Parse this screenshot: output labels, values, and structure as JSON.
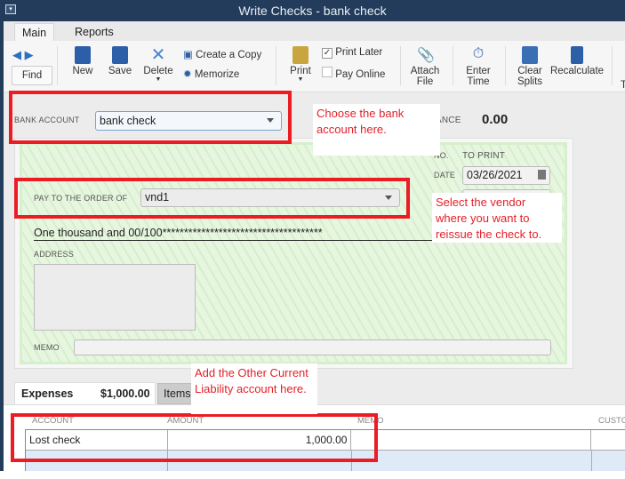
{
  "window": {
    "title": "Write Checks - bank check"
  },
  "ribbon_tabs": [
    {
      "label": "Main"
    },
    {
      "label": "Reports"
    }
  ],
  "toolbar": {
    "find": "Find",
    "new": "New",
    "save": "Save",
    "delete": "Delete",
    "create_copy": "Create a Copy",
    "memorize": "Memorize",
    "print": "Print",
    "print_later": "Print Later",
    "print_later_checked": true,
    "pay_online": "Pay Online",
    "pay_online_checked": false,
    "attach_file": [
      "Attach",
      "File"
    ],
    "enter_time": [
      "Enter",
      "Time"
    ],
    "clear_splits": [
      "Clear",
      "Splits"
    ],
    "recalculate": "Recalculate",
    "more": "T"
  },
  "bank": {
    "label": "BANK ACCOUNT",
    "value": "bank check",
    "balance_label": "ANCE",
    "balance": "0.00"
  },
  "check": {
    "no_label": "NO.",
    "no_value": "TO PRINT",
    "date_label": "DATE",
    "date": "03/26/2021",
    "payee_label": "PAY TO THE ORDER OF",
    "payee": "vnd1",
    "amount_words": "One thousand  and 00/100*************************************",
    "address_label": "ADDRESS",
    "memo_label": "MEMO"
  },
  "callouts": {
    "bank": "Choose the bank account here.",
    "vendor": "Select the vendor where you want to reissue the check to.",
    "account": "Add the Other Current Liability account here."
  },
  "detail_tabs": {
    "expenses": "Expenses",
    "expenses_total": "$1,000.00",
    "items": "Items"
  },
  "grid": {
    "columns": [
      "ACCOUNT",
      "AMOUNT",
      "MEMO",
      "CUSTO"
    ],
    "rows": [
      {
        "account": "Lost check",
        "amount": "1,000.00",
        "memo": ""
      }
    ]
  },
  "colors": {
    "titlebar": "#233c5b",
    "highlight": "#ec1c24",
    "check_bg": "#e6f6df"
  }
}
